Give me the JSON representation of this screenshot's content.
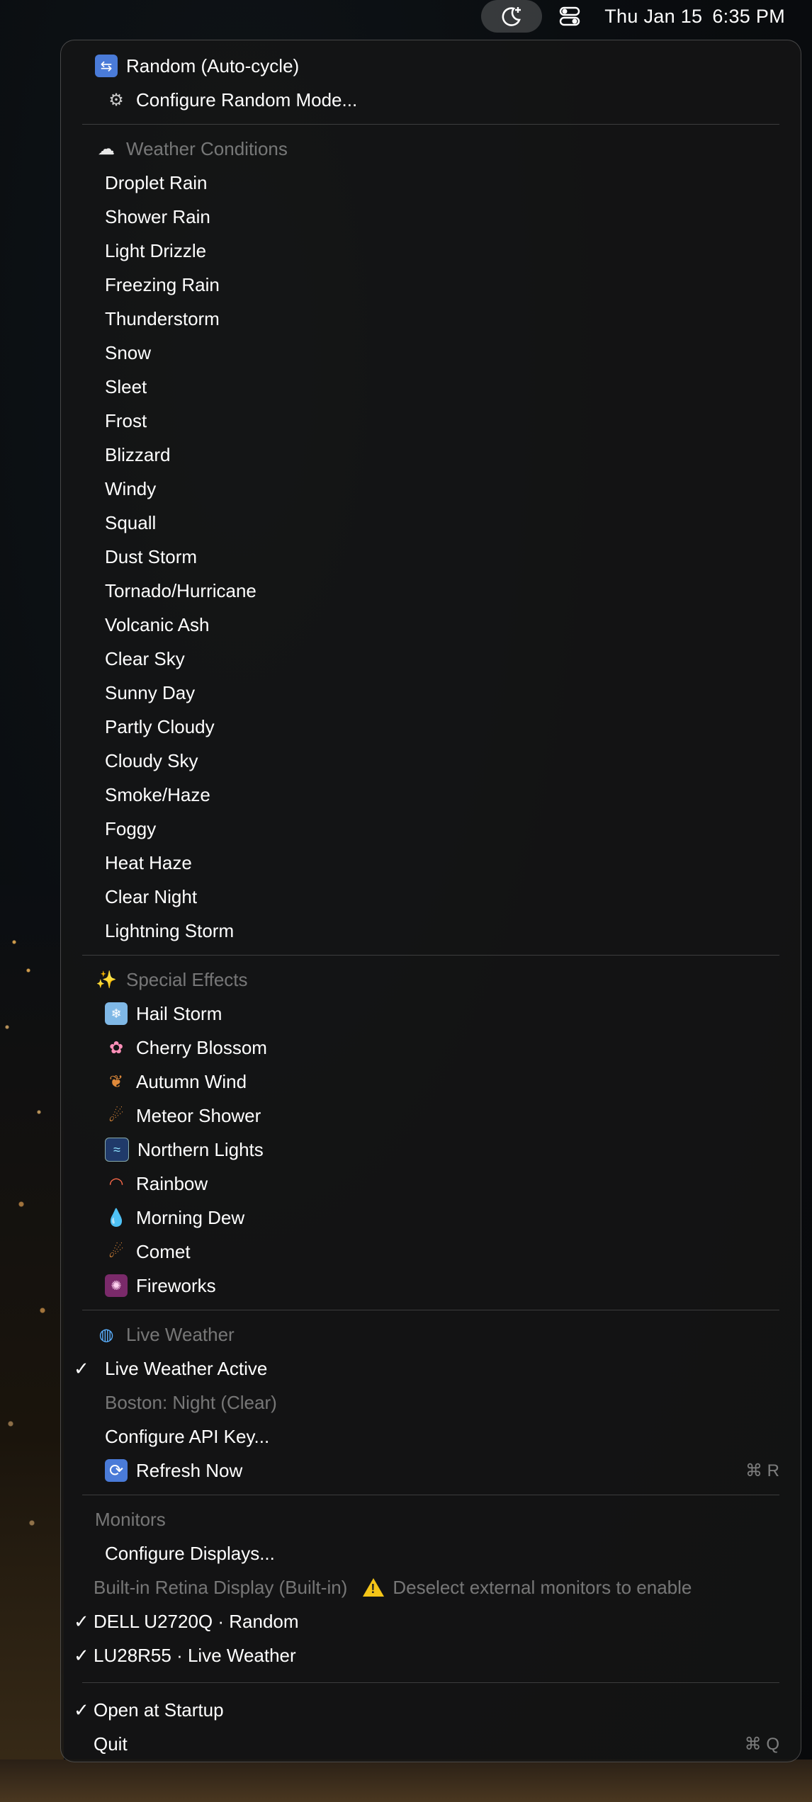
{
  "menubar": {
    "icons": [
      "moon-sparkle-icon",
      "control-center-icon"
    ],
    "date": "Thu Jan 15",
    "time": "6:35 PM"
  },
  "menu": {
    "top": [
      {
        "icon": "shuffle-icon",
        "glyph": "⇆",
        "label": "Random (Auto-cycle)"
      },
      {
        "icon": "gear-icon",
        "glyph": "⚙",
        "label": "Configure Random Mode..."
      }
    ],
    "weather_header": {
      "icon": "cloud-icon",
      "glyph": "☁",
      "label": "Weather Conditions"
    },
    "weather": [
      "Droplet Rain",
      "Shower Rain",
      "Light Drizzle",
      "Freezing Rain",
      "Thunderstorm",
      "Snow",
      "Sleet",
      "Frost",
      "Blizzard",
      "Windy",
      "Squall",
      "Dust Storm",
      "Tornado/Hurricane",
      "Volcanic Ash",
      "Clear Sky",
      "Sunny Day",
      "Partly Cloudy",
      "Cloudy Sky",
      "Smoke/Haze",
      "Foggy",
      "Heat Haze",
      "Clear Night",
      "Lightning Storm"
    ],
    "effects_header": {
      "icon": "sparkles-icon",
      "glyph": "✨",
      "label": "Special Effects"
    },
    "effects": [
      {
        "icon": "ice-cube-icon",
        "glyph": "❄",
        "label": "Hail Storm"
      },
      {
        "icon": "cherry-blossom-icon",
        "glyph": "✿",
        "label": "Cherry Blossom"
      },
      {
        "icon": "autumn-leaf-icon",
        "glyph": "❦",
        "label": "Autumn Wind"
      },
      {
        "icon": "meteor-icon",
        "glyph": "☄",
        "label": "Meteor Shower"
      },
      {
        "icon": "aurora-icon",
        "glyph": "≈",
        "label": "Northern Lights"
      },
      {
        "icon": "rainbow-icon",
        "glyph": "◠",
        "label": "Rainbow"
      },
      {
        "icon": "droplet-icon",
        "glyph": "💧",
        "label": "Morning Dew"
      },
      {
        "icon": "comet-icon",
        "glyph": "☄",
        "label": "Comet"
      },
      {
        "icon": "fireworks-icon",
        "glyph": "✺",
        "label": "Fireworks"
      }
    ],
    "live_header": {
      "icon": "globe-icon",
      "glyph": "◍",
      "label": "Live Weather"
    },
    "live": {
      "active_label": "Live Weather Active",
      "active_checked": true,
      "status": "Boston: Night (Clear)",
      "api_label": "Configure API Key...",
      "refresh": {
        "icon": "refresh-icon",
        "glyph": "⟳",
        "label": "Refresh Now",
        "shortcut": "⌘ R"
      }
    },
    "monitors_header": "Monitors",
    "monitors": {
      "configure_label": "Configure Displays...",
      "builtin_label": "Built-in Retina Display (Built-in)",
      "builtin_warning": "Deselect external monitors to enable",
      "displays": [
        {
          "label": "DELL U2720Q · Random",
          "checked": true
        },
        {
          "label": "LU28R55 · Live Weather",
          "checked": true
        }
      ]
    },
    "footer": {
      "startup_label": "Open at Startup",
      "startup_checked": true,
      "quit_label": "Quit",
      "quit_shortcut": "⌘ Q"
    }
  }
}
